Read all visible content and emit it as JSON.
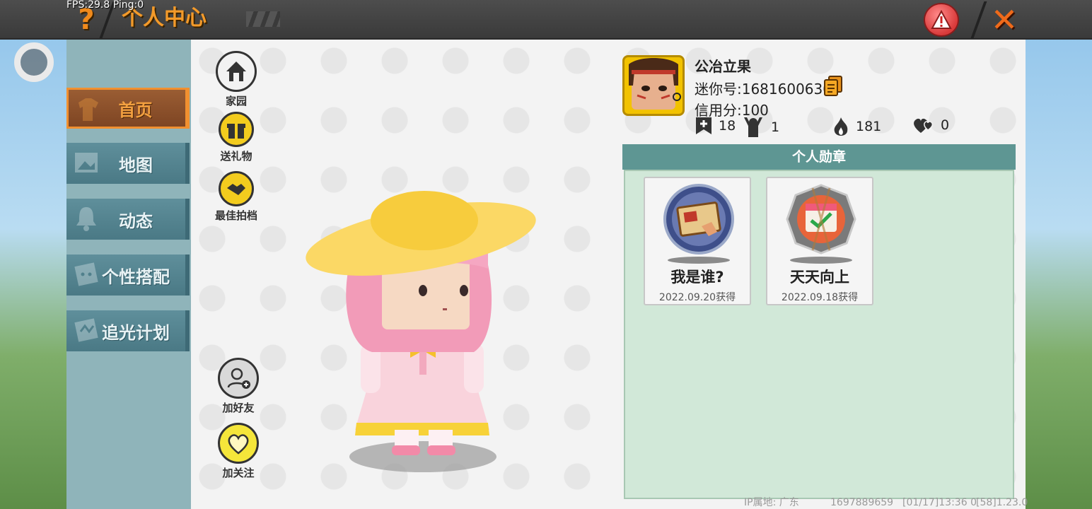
{
  "overlay": {
    "fps": "FPS:29.8  Ping:0"
  },
  "header": {
    "title": "个人中心",
    "help_icon": "question-icon",
    "report_icon": "warning-icon",
    "close_icon": "close-icon"
  },
  "sidebar": {
    "items": [
      {
        "label": "首页",
        "icon": "shirt-icon",
        "active": true
      },
      {
        "label": "地图",
        "icon": "map-icon",
        "active": false
      },
      {
        "label": "动态",
        "icon": "bell-icon",
        "active": false
      },
      {
        "label": "个性搭配",
        "icon": "avatar-icon",
        "active": false
      },
      {
        "label": "追光计划",
        "icon": "badge-icon",
        "active": false
      }
    ]
  },
  "actions": {
    "home": "家园",
    "gift": "送礼物",
    "partner": "最佳拍档",
    "add_friend": "加好友",
    "follow": "加关注"
  },
  "profile": {
    "name": "公冶立果",
    "mini_id": "迷你号:1681600630",
    "credit": "信用分:100",
    "stats": {
      "posts": "18",
      "fans": "1",
      "heat": "181",
      "likes": "0"
    }
  },
  "badges": {
    "title": "个人勋章",
    "items": [
      {
        "name": "我是谁?",
        "date": "2022.09.20获得"
      },
      {
        "name": "天天向上",
        "date": "2022.09.18获得"
      }
    ]
  },
  "footer": {
    "ip": "IP属地: 广东",
    "uid": "1697889659",
    "time": "[01/17]13:36 0",
    "version": "[58]1.23.0"
  },
  "colors": {
    "accent": "#f19030",
    "sidebar": "#4a7985",
    "badge_header": "#5e9693",
    "badge_bg": "#d1e8d8"
  }
}
